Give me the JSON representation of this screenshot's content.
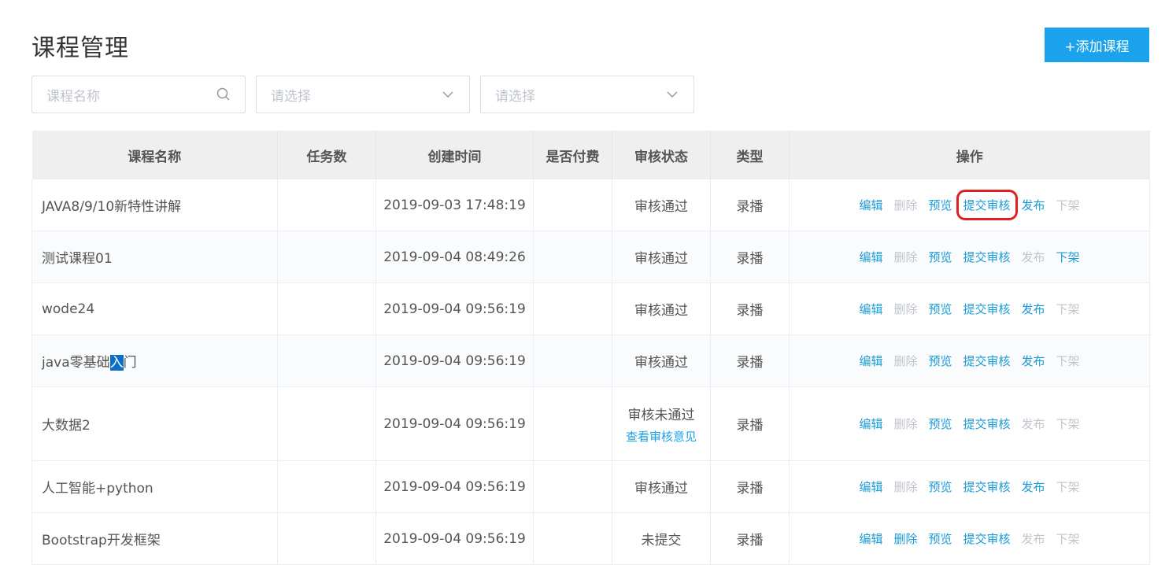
{
  "header": {
    "title": "课程管理",
    "add_button": "+添加课程"
  },
  "filters": {
    "course_name_placeholder": "课程名称",
    "select1_placeholder": "请选择",
    "select2_placeholder": "请选择"
  },
  "table": {
    "columns": [
      "课程名称",
      "任务数",
      "创建时间",
      "是否付费",
      "审核状态",
      "类型",
      "操作"
    ],
    "actions": [
      "编辑",
      "删除",
      "预览",
      "提交审核",
      "发布",
      "下架"
    ],
    "rows": [
      {
        "name": "JAVA8/9/10新特性讲解",
        "tasks": "",
        "created": "2019-09-03 17:48:19",
        "paid": "",
        "status": "审核通过",
        "status_link": "",
        "type": "录播"
      },
      {
        "name": "测试课程01",
        "tasks": "",
        "created": "2019-09-04 08:49:26",
        "paid": "",
        "status": "审核通过",
        "status_link": "",
        "type": "录播"
      },
      {
        "name": "wode24",
        "tasks": "",
        "created": "2019-09-04 09:56:19",
        "paid": "",
        "status": "审核通过",
        "status_link": "",
        "type": "录播"
      },
      {
        "name_a": "java零基础",
        "name_b": "入",
        "name_c": "门",
        "tasks": "",
        "created": "2019-09-04 09:56:19",
        "paid": "",
        "status": "审核通过",
        "status_link": "",
        "type": "录播"
      },
      {
        "name": "大数据2",
        "tasks": "",
        "created": "2019-09-04 09:56:19",
        "paid": "",
        "status": "审核未通过",
        "status_link": "查看审核意见",
        "type": "录播"
      },
      {
        "name": "人工智能+python",
        "tasks": "",
        "created": "2019-09-04 09:56:19",
        "paid": "",
        "status": "审核通过",
        "status_link": "",
        "type": "录播"
      },
      {
        "name": "Bootstrap开发框架",
        "tasks": "",
        "created": "2019-09-04 09:56:19",
        "paid": "",
        "status": "未提交",
        "status_link": "",
        "type": "录播"
      }
    ]
  },
  "colors": {
    "accent": "#1aa3ec",
    "link": "#1a9bd7",
    "disabled": "#c0c4cc",
    "highlight_box": "#e02020"
  },
  "icons": {
    "search": "search-icon",
    "chevron": "chevron-down-icon"
  }
}
